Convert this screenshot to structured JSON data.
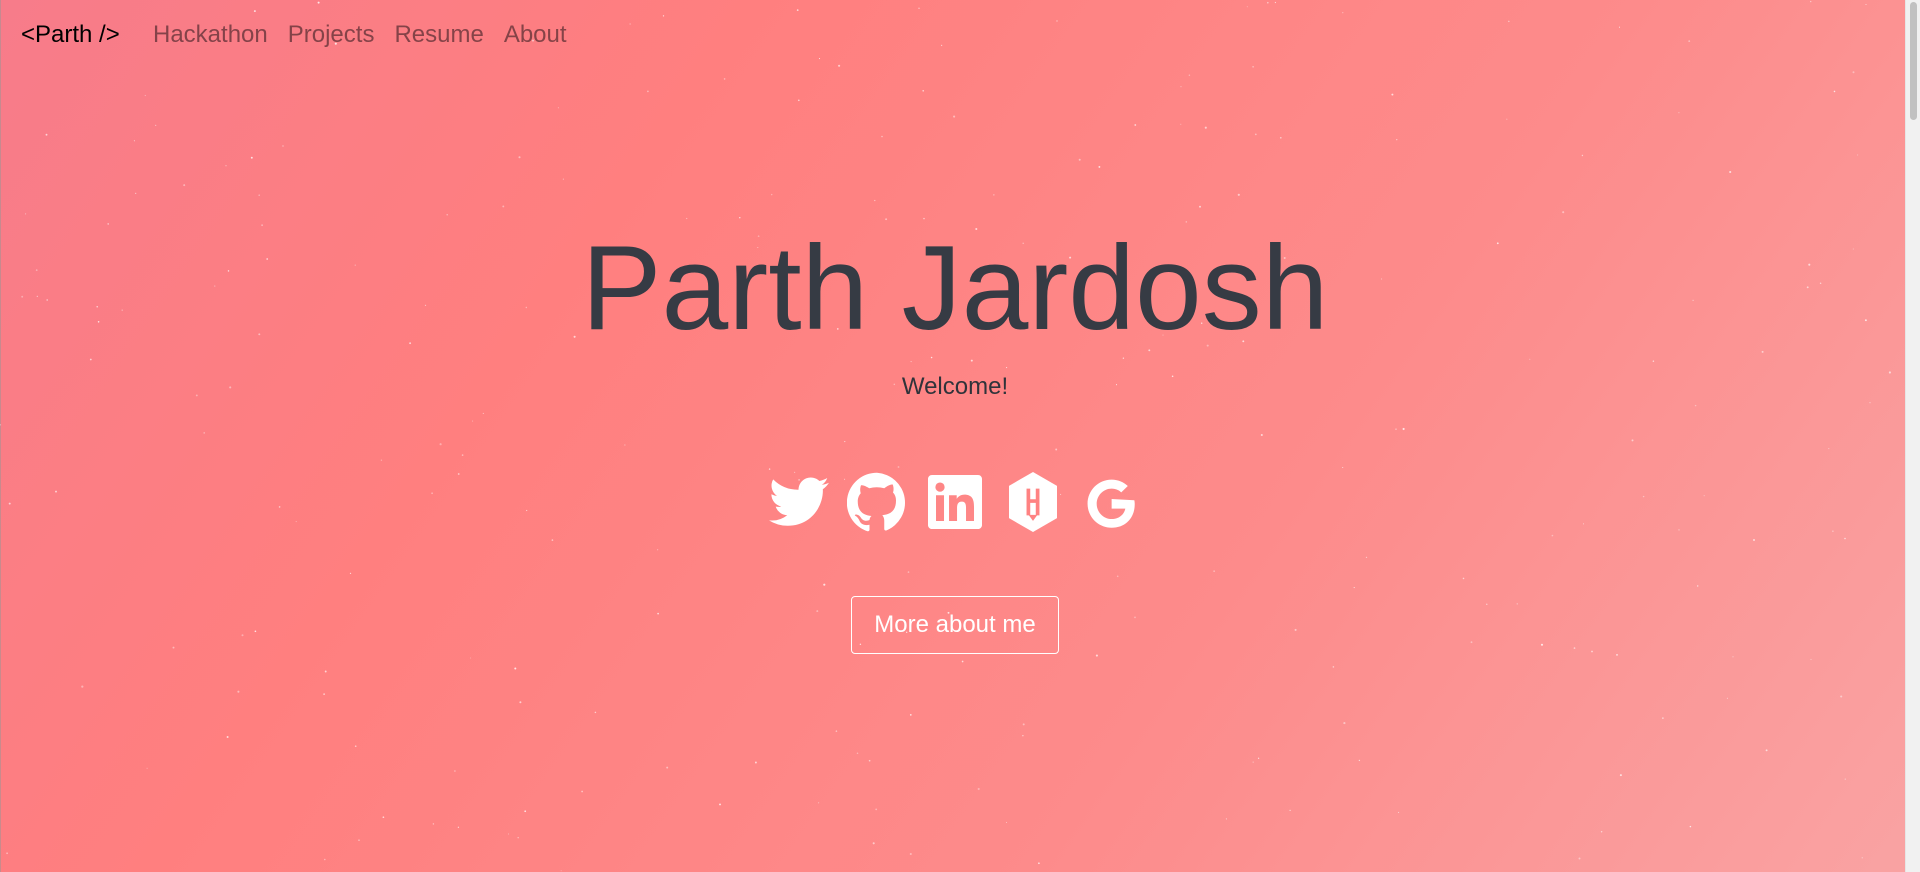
{
  "navbar": {
    "brand": "<Parth />",
    "links": [
      "Hackathon",
      "Projects",
      "Resume",
      "About"
    ]
  },
  "hero": {
    "title": "Parth Jardosh",
    "subtitle": "Welcome!",
    "button_label": "More about me"
  },
  "socials": [
    {
      "icon": "twitter-icon"
    },
    {
      "icon": "github-icon"
    },
    {
      "icon": "linkedin-icon"
    },
    {
      "icon": "hackerrank-icon"
    },
    {
      "icon": "google-icon"
    }
  ],
  "colors": {
    "background_start": "#f77c8a",
    "background_mid": "#ff7f7f",
    "background_end": "#f9a3a3",
    "title": "#363b44",
    "icon": "#ffffff"
  }
}
